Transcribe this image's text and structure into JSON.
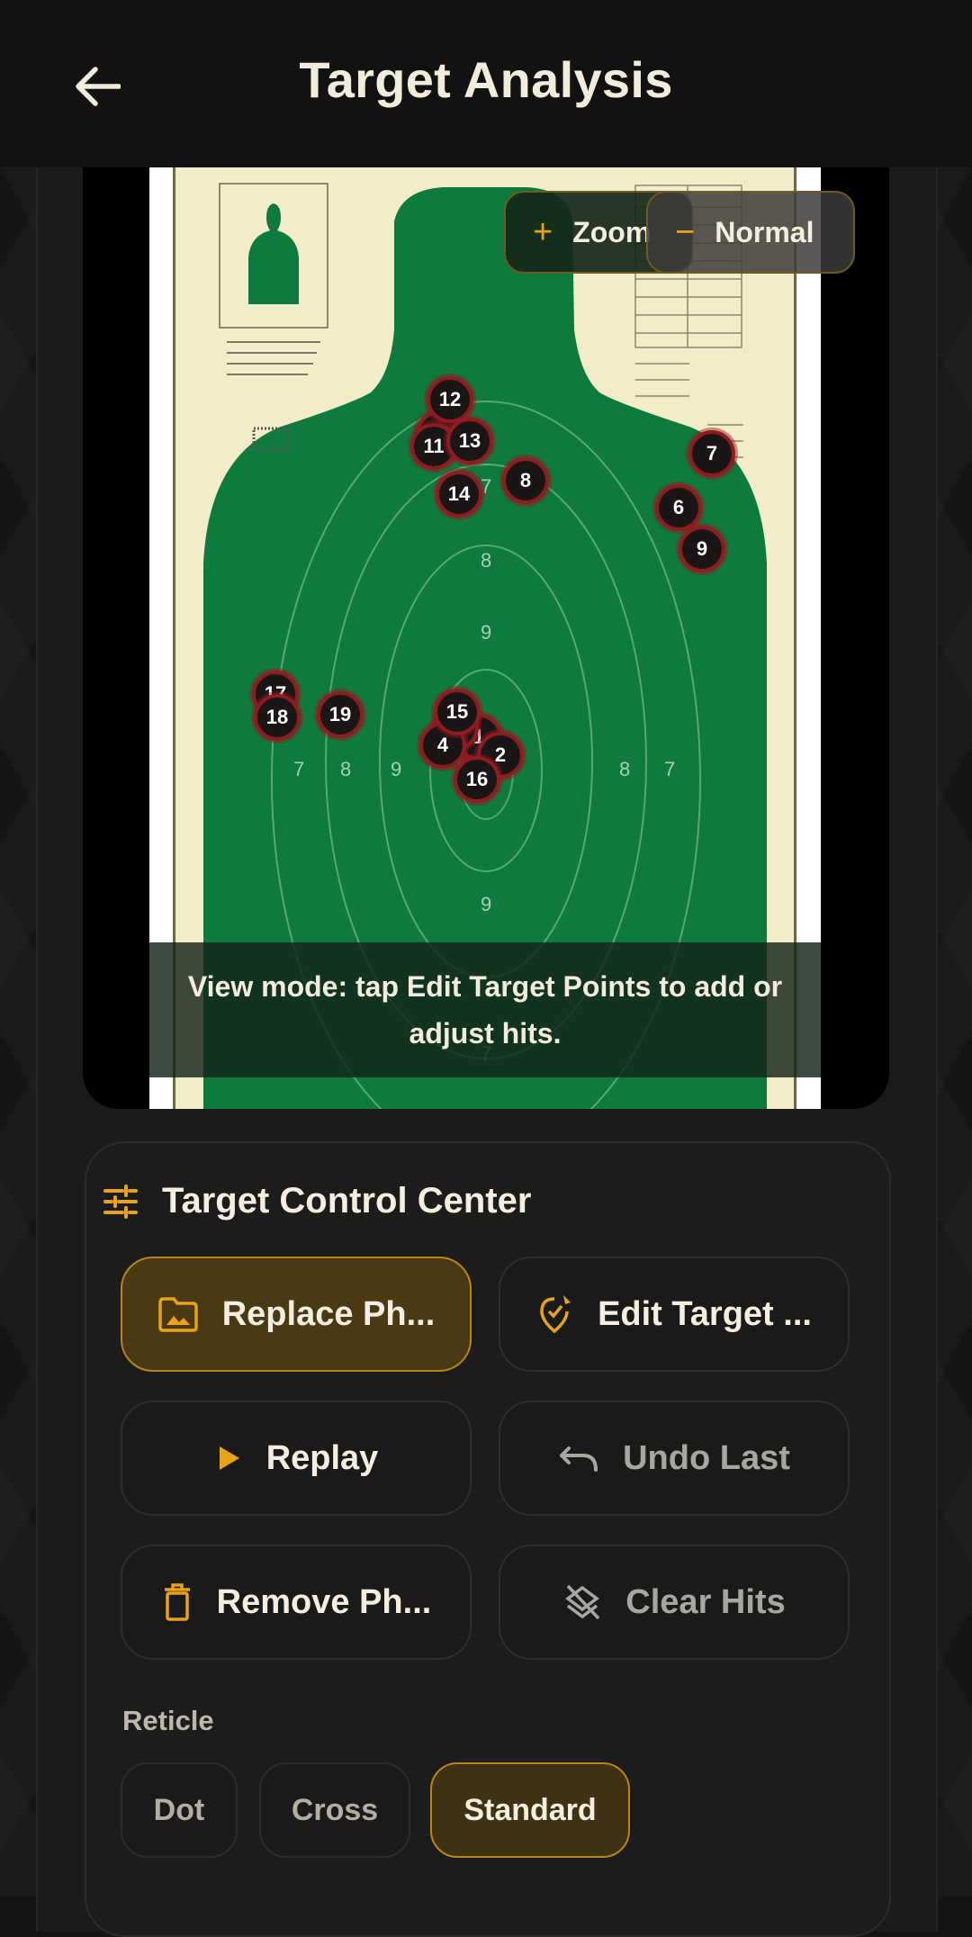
{
  "header": {
    "title": "Target Analysis",
    "back_icon": "arrow-left-icon"
  },
  "image_controls": {
    "zoom_label": "Zoom",
    "normal_label": "Normal"
  },
  "target_print": {
    "rings": [
      "7",
      "8",
      "9",
      "7",
      "8",
      "9",
      "8",
      "7",
      "9",
      "7"
    ]
  },
  "hits": [
    {
      "n": "1"
    },
    {
      "n": "2"
    },
    {
      "n": "3"
    },
    {
      "n": "4"
    },
    {
      "n": "6"
    },
    {
      "n": "7"
    },
    {
      "n": "8"
    },
    {
      "n": "9"
    },
    {
      "n": "10"
    },
    {
      "n": "11"
    },
    {
      "n": "12"
    },
    {
      "n": "13"
    },
    {
      "n": "14"
    },
    {
      "n": "15"
    },
    {
      "n": "16"
    },
    {
      "n": "17"
    },
    {
      "n": "18"
    },
    {
      "n": "19"
    }
  ],
  "overlay_message": "View mode: tap Edit Target Points to add or adjust hits.",
  "control_center": {
    "title": "Target Control Center",
    "buttons": {
      "replace_photo": "Replace Ph...",
      "edit_target": "Edit Target ...",
      "replay": "Replay",
      "undo_last": "Undo Last",
      "remove_photo": "Remove Ph...",
      "clear_hits": "Clear Hits"
    },
    "reticle_label": "Reticle",
    "reticle_options": [
      "Dot",
      "Cross",
      "Standard"
    ],
    "reticle_selected": "Standard"
  },
  "colors": {
    "accent": "#E8A21C",
    "target_green": "#0E7A3E",
    "paper": "#F3ECC8",
    "hit_ring": "#8E1D22"
  }
}
